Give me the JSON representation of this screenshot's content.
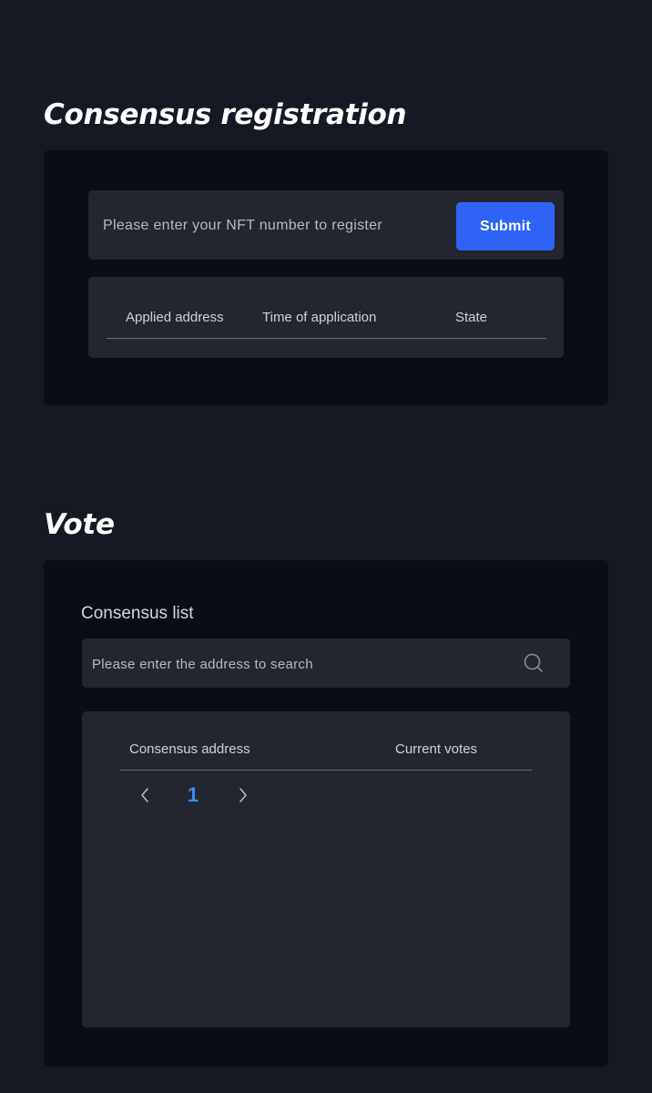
{
  "registration": {
    "title": "Consensus registration",
    "nft_placeholder": "Please enter your NFT number to register",
    "submit_label": "Submit",
    "table_headers": [
      "Applied address",
      "Time of application",
      "State"
    ]
  },
  "vote": {
    "title": "Vote",
    "list_label": "Consensus list",
    "search_placeholder": "Please enter the address to search",
    "table_headers": [
      "Consensus address",
      "Current votes"
    ],
    "pagination": {
      "current_page": "1"
    }
  },
  "icons": {
    "search": "search-icon",
    "prev": "chevron-left-icon",
    "next": "chevron-right-icon"
  },
  "colors": {
    "background": "#151923",
    "panel": "#0a0d14",
    "card": "#232631",
    "accent_button": "#2e63f6",
    "active_page": "#3a8cf6"
  }
}
